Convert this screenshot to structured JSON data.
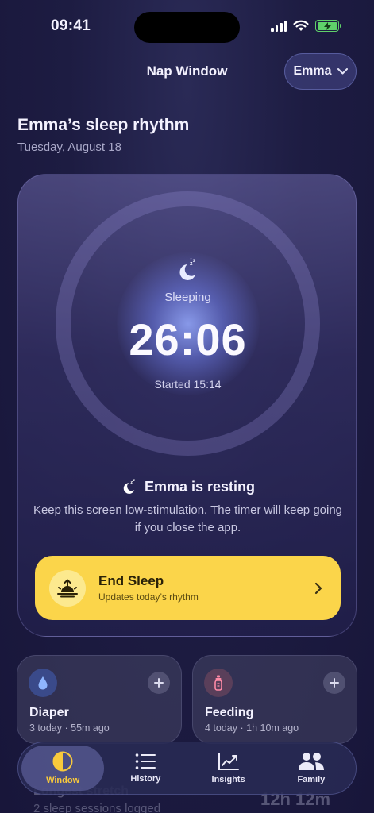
{
  "status_bar": {
    "time": "09:41"
  },
  "nav": {
    "title": "Nap Window",
    "profile_label": "Emma"
  },
  "header": {
    "headline": "Emma’s sleep rhythm",
    "date": "Tuesday, August 18"
  },
  "sleep_card": {
    "status": "Sleeping",
    "timer": "26:06",
    "started": "Started 15:14",
    "resting": "Emma is resting",
    "note": "Keep this screen low-stimulation. The timer will keep going if you close the app.",
    "end_button": {
      "title": "End Sleep",
      "subtitle": "Updates today’s rhythm"
    }
  },
  "quick_cards": [
    {
      "title": "Diaper",
      "subtitle": "3 today · 55m ago",
      "icon": "water-drop-icon",
      "icon_bg": "#3a4a8a",
      "icon_color": "#8fb6ff"
    },
    {
      "title": "Feeding",
      "subtitle": "4 today · 1h 10m ago",
      "icon": "bottle-icon",
      "icon_bg": "#5a3f5a",
      "icon_color": "#ff8aa6"
    }
  ],
  "peek": {
    "left_title": "Longest stretch",
    "left_sub": "2 sleep sessions logged",
    "right_value": "12h 12m"
  },
  "tabs": [
    {
      "label": "Window",
      "icon": "half-circle-icon",
      "active": true
    },
    {
      "label": "History",
      "icon": "list-icon",
      "active": false
    },
    {
      "label": "Insights",
      "icon": "chart-line-icon",
      "active": false
    },
    {
      "label": "Family",
      "icon": "people-icon",
      "active": false
    }
  ],
  "colors": {
    "accent": "#fbd54a",
    "active_tab": "#f8c93c",
    "battery": "#5fd16a"
  }
}
